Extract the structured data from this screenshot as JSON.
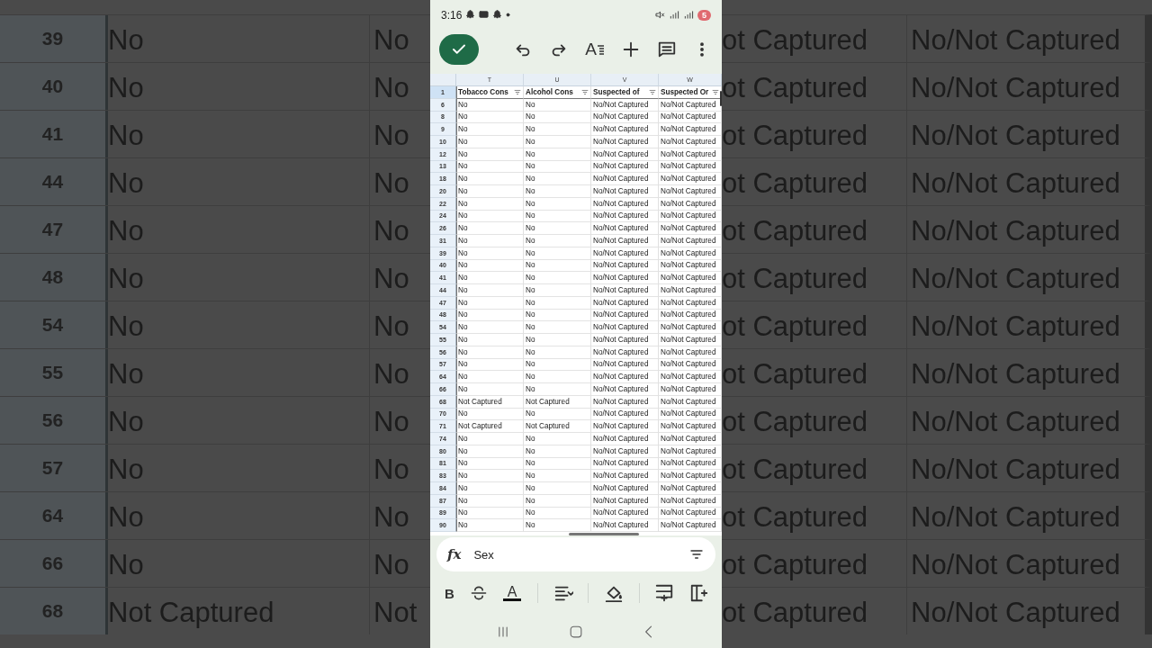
{
  "background": {
    "left_rows": [
      {
        "row_number": "39",
        "column_1": "No",
        "column_2": "No"
      },
      {
        "row_number": "40",
        "column_1": "No",
        "column_2": "No"
      },
      {
        "row_number": "41",
        "column_1": "No",
        "column_2": "No"
      },
      {
        "row_number": "44",
        "column_1": "No",
        "column_2": "No"
      },
      {
        "row_number": "47",
        "column_1": "No",
        "column_2": "No"
      },
      {
        "row_number": "48",
        "column_1": "No",
        "column_2": "No"
      },
      {
        "row_number": "54",
        "column_1": "No",
        "column_2": "No"
      },
      {
        "row_number": "55",
        "column_1": "No",
        "column_2": "No"
      },
      {
        "row_number": "56",
        "column_1": "No",
        "column_2": "No"
      },
      {
        "row_number": "57",
        "column_1": "No",
        "column_2": "No"
      },
      {
        "row_number": "64",
        "column_1": "No",
        "column_2": "No"
      },
      {
        "row_number": "66",
        "column_1": "No",
        "column_2": "No"
      },
      {
        "row_number": "68",
        "column_1": "Not Captured",
        "column_2": "Not"
      }
    ],
    "right_rows": [
      {
        "column_1": "ot Captured",
        "column_2": "No/Not Captured"
      },
      {
        "column_1": "ot Captured",
        "column_2": "No/Not Captured"
      },
      {
        "column_1": "ot Captured",
        "column_2": "No/Not Captured"
      },
      {
        "column_1": "ot Captured",
        "column_2": "No/Not Captured"
      },
      {
        "column_1": "ot Captured",
        "column_2": "No/Not Captured"
      },
      {
        "column_1": "ot Captured",
        "column_2": "No/Not Captured"
      },
      {
        "column_1": "ot Captured",
        "column_2": "No/Not Captured"
      },
      {
        "column_1": "ot Captured",
        "column_2": "No/Not Captured"
      },
      {
        "column_1": "ot Captured",
        "column_2": "No/Not Captured"
      },
      {
        "column_1": "ot Captured",
        "column_2": "No/Not Captured"
      },
      {
        "column_1": "ot Captured",
        "column_2": "No/Not Captured"
      },
      {
        "column_1": "ot Captured",
        "column_2": "No/Not Captured"
      },
      {
        "column_1": "ot Captured",
        "column_2": "No/Not Captured"
      }
    ]
  },
  "status_bar": {
    "time": "3:16",
    "battery": "5"
  },
  "toolbar": {
    "format_letter": "A"
  },
  "sheet": {
    "columns": [
      "T",
      "U",
      "V",
      "W"
    ],
    "header": {
      "row_number": "1",
      "cells": [
        "Tobacco Cons",
        "Alcohol Cons",
        "Suspected of",
        "Suspected Or"
      ]
    },
    "rows": [
      {
        "row_number": "6",
        "cells": [
          "No",
          "No",
          "No/Not Captured",
          "No/Not Captured"
        ]
      },
      {
        "row_number": "8",
        "cells": [
          "No",
          "No",
          "No/Not Captured",
          "No/Not Captured"
        ]
      },
      {
        "row_number": "9",
        "cells": [
          "No",
          "No",
          "No/Not Captured",
          "No/Not Captured"
        ]
      },
      {
        "row_number": "10",
        "cells": [
          "No",
          "No",
          "No/Not Captured",
          "No/Not Captured"
        ]
      },
      {
        "row_number": "12",
        "cells": [
          "No",
          "No",
          "No/Not Captured",
          "No/Not Captured"
        ]
      },
      {
        "row_number": "13",
        "cells": [
          "No",
          "No",
          "No/Not Captured",
          "No/Not Captured"
        ]
      },
      {
        "row_number": "18",
        "cells": [
          "No",
          "No",
          "No/Not Captured",
          "No/Not Captured"
        ]
      },
      {
        "row_number": "20",
        "cells": [
          "No",
          "No",
          "No/Not Captured",
          "No/Not Captured"
        ]
      },
      {
        "row_number": "22",
        "cells": [
          "No",
          "No",
          "No/Not Captured",
          "No/Not Captured"
        ]
      },
      {
        "row_number": "24",
        "cells": [
          "No",
          "No",
          "No/Not Captured",
          "No/Not Captured"
        ]
      },
      {
        "row_number": "26",
        "cells": [
          "No",
          "No",
          "No/Not Captured",
          "No/Not Captured"
        ]
      },
      {
        "row_number": "31",
        "cells": [
          "No",
          "No",
          "No/Not Captured",
          "No/Not Captured"
        ]
      },
      {
        "row_number": "39",
        "cells": [
          "No",
          "No",
          "No/Not Captured",
          "No/Not Captured"
        ]
      },
      {
        "row_number": "40",
        "cells": [
          "No",
          "No",
          "No/Not Captured",
          "No/Not Captured"
        ]
      },
      {
        "row_number": "41",
        "cells": [
          "No",
          "No",
          "No/Not Captured",
          "No/Not Captured"
        ]
      },
      {
        "row_number": "44",
        "cells": [
          "No",
          "No",
          "No/Not Captured",
          "No/Not Captured"
        ]
      },
      {
        "row_number": "47",
        "cells": [
          "No",
          "No",
          "No/Not Captured",
          "No/Not Captured"
        ]
      },
      {
        "row_number": "48",
        "cells": [
          "No",
          "No",
          "No/Not Captured",
          "No/Not Captured"
        ]
      },
      {
        "row_number": "54",
        "cells": [
          "No",
          "No",
          "No/Not Captured",
          "No/Not Captured"
        ]
      },
      {
        "row_number": "55",
        "cells": [
          "No",
          "No",
          "No/Not Captured",
          "No/Not Captured"
        ]
      },
      {
        "row_number": "56",
        "cells": [
          "No",
          "No",
          "No/Not Captured",
          "No/Not Captured"
        ]
      },
      {
        "row_number": "57",
        "cells": [
          "No",
          "No",
          "No/Not Captured",
          "No/Not Captured"
        ]
      },
      {
        "row_number": "64",
        "cells": [
          "No",
          "No",
          "No/Not Captured",
          "No/Not Captured"
        ]
      },
      {
        "row_number": "66",
        "cells": [
          "No",
          "No",
          "No/Not Captured",
          "No/Not Captured"
        ]
      },
      {
        "row_number": "68",
        "cells": [
          "Not Captured",
          "Not Captured",
          "No/Not Captured",
          "No/Not Captured"
        ]
      },
      {
        "row_number": "70",
        "cells": [
          "No",
          "No",
          "No/Not Captured",
          "No/Not Captured"
        ]
      },
      {
        "row_number": "71",
        "cells": [
          "Not Captured",
          "Not Captured",
          "No/Not Captured",
          "No/Not Captured"
        ]
      },
      {
        "row_number": "74",
        "cells": [
          "No",
          "No",
          "No/Not Captured",
          "No/Not Captured"
        ]
      },
      {
        "row_number": "80",
        "cells": [
          "No",
          "No",
          "No/Not Captured",
          "No/Not Captured"
        ]
      },
      {
        "row_number": "81",
        "cells": [
          "No",
          "No",
          "No/Not Captured",
          "No/Not Captured"
        ]
      },
      {
        "row_number": "83",
        "cells": [
          "No",
          "No",
          "No/Not Captured",
          "No/Not Captured"
        ]
      },
      {
        "row_number": "84",
        "cells": [
          "No",
          "No",
          "No/Not Captured",
          "No/Not Captured"
        ]
      },
      {
        "row_number": "87",
        "cells": [
          "No",
          "No",
          "No/Not Captured",
          "No/Not Captured"
        ]
      },
      {
        "row_number": "89",
        "cells": [
          "No",
          "No",
          "No/Not Captured",
          "No/Not Captured"
        ]
      },
      {
        "row_number": "90",
        "cells": [
          "No",
          "No",
          "No/Not Captured",
          "No/Not Captured"
        ]
      }
    ]
  },
  "formula_bar": {
    "icon": "fx",
    "value": "Sex"
  },
  "format_bar": {
    "bold_letter": "B",
    "text_color_letter": "A"
  }
}
